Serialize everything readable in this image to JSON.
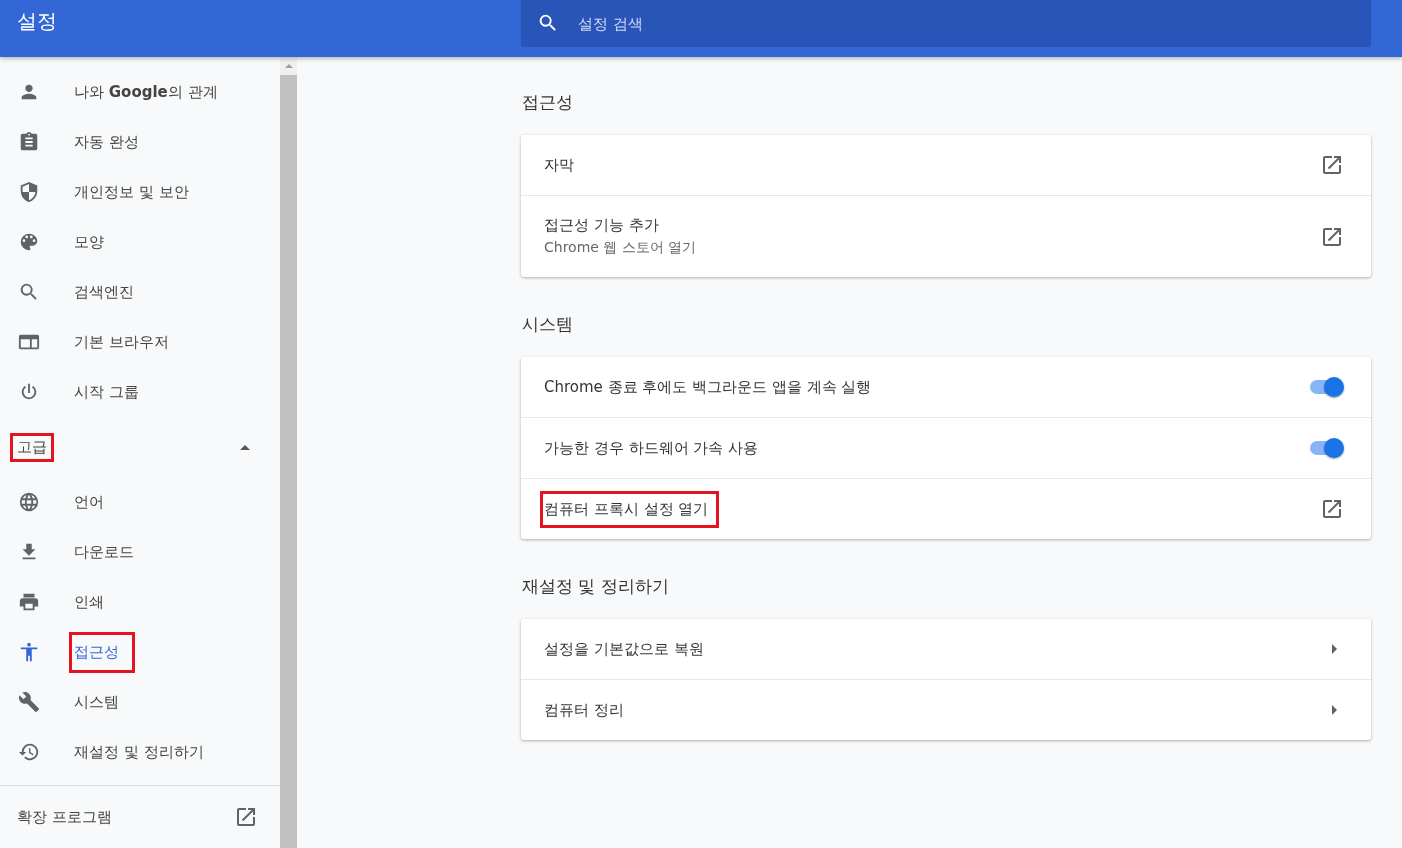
{
  "header": {
    "title": "설정",
    "search": {
      "placeholder": "설정 검색"
    }
  },
  "sidebar": {
    "items": [
      {
        "kind": "person",
        "label": "나와 **Google**의 관계",
        "selected": false,
        "highlighted": false
      },
      {
        "kind": "clipboard",
        "label": "자동 완성",
        "selected": false,
        "highlighted": false
      },
      {
        "kind": "shield",
        "label": "개인정보 및 보안",
        "selected": false,
        "highlighted": false
      },
      {
        "kind": "palette",
        "label": "모양",
        "selected": false,
        "highlighted": false
      },
      {
        "kind": "search",
        "label": "검색엔진",
        "selected": false,
        "highlighted": false
      },
      {
        "kind": "browser",
        "label": "기본 브라우저",
        "selected": false,
        "highlighted": false
      },
      {
        "kind": "power",
        "label": "시작 그룹",
        "selected": false,
        "highlighted": false
      }
    ],
    "advanced": {
      "label": "고급",
      "expanded": true,
      "highlighted": true,
      "items": [
        {
          "kind": "globe",
          "label": "언어",
          "selected": false,
          "highlighted": false
        },
        {
          "kind": "download",
          "label": "다운로드",
          "selected": false,
          "highlighted": false
        },
        {
          "kind": "printer",
          "label": "인쇄",
          "selected": false,
          "highlighted": false
        },
        {
          "kind": "accessibility",
          "label": "접근성",
          "selected": true,
          "highlighted": true
        },
        {
          "kind": "wrench",
          "label": "시스템",
          "selected": false,
          "highlighted": false
        },
        {
          "kind": "history",
          "label": "재설정 및 정리하기",
          "selected": false,
          "highlighted": false
        }
      ]
    },
    "extensions": {
      "label": "확장 프로그램"
    }
  },
  "sections": [
    {
      "title": "접근성",
      "rows": [
        {
          "kind": "link",
          "label": "자막",
          "highlighted": false
        },
        {
          "kind": "link",
          "label": "접근성 기능 추가",
          "sublabel": "Chrome 웹 스토어 열기",
          "highlighted": false
        }
      ]
    },
    {
      "title": "시스템",
      "rows": [
        {
          "kind": "toggle",
          "label": "Chrome 종료 후에도 백그라운드 앱을 계속 실행",
          "on": true,
          "highlighted": false
        },
        {
          "kind": "toggle",
          "label": "가능한 경우 하드웨어 가속 사용",
          "on": true,
          "highlighted": false
        },
        {
          "kind": "link",
          "label": "컴퓨터 프록시 설정 열기",
          "highlighted": true
        }
      ]
    },
    {
      "title": "재설정 및 정리하기",
      "rows": [
        {
          "kind": "arrow",
          "label": "설정을 기본값으로 복원",
          "highlighted": false
        },
        {
          "kind": "arrow",
          "label": "컴퓨터 정리",
          "highlighted": false
        }
      ]
    }
  ]
}
